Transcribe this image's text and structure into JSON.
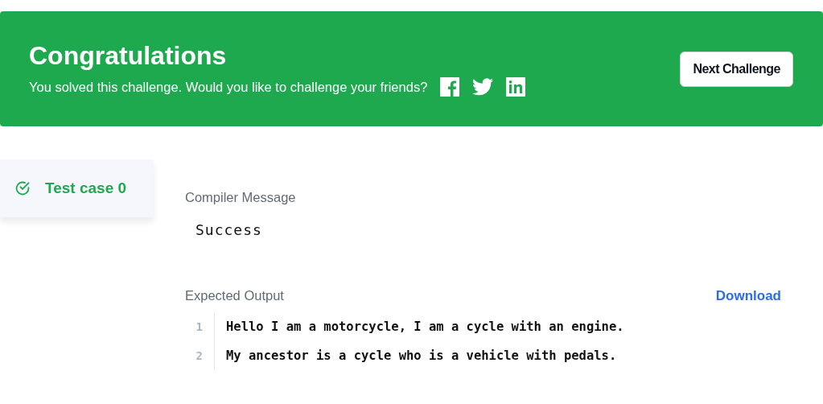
{
  "banner": {
    "title": "Congratulations",
    "message": "You solved this challenge. Would you like to challenge your friends?",
    "share": [
      {
        "kind": "facebook"
      },
      {
        "kind": "twitter"
      },
      {
        "kind": "linkedin"
      }
    ],
    "button": "Next Challenge"
  },
  "test_cases": [
    {
      "label": "Test case 0",
      "selected": true,
      "passed": true
    }
  ],
  "compiler_message": {
    "label": "Compiler Message",
    "text": "Success"
  },
  "expected_output": {
    "label": "Expected Output",
    "action": "Download",
    "lines": [
      {
        "number": "1",
        "text": "Hello I am a motorcycle, I am a cycle with an engine."
      },
      {
        "number": "2",
        "text": "My ancestor is a cycle who is a vehicle with pedals."
      }
    ]
  }
}
